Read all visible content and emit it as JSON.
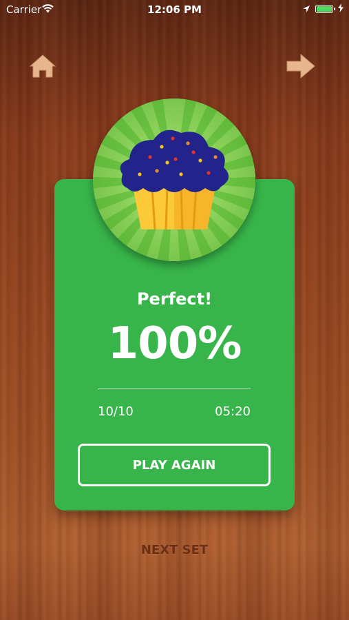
{
  "status_bar": {
    "carrier": "Carrier",
    "time": "12:06 PM",
    "battery_color": "#4cd964"
  },
  "nav": {
    "home_icon": "home-icon",
    "next_icon": "arrow-right-icon"
  },
  "result_card": {
    "badge_icon": "cupcake-icon",
    "heading": "Perfect!",
    "percentage": "100%",
    "score": "10/10",
    "time": "05:20",
    "play_again_label": "PLAY AGAIN",
    "card_color": "#38b54a"
  },
  "footer": {
    "next_set_label": "NEXT SET"
  }
}
